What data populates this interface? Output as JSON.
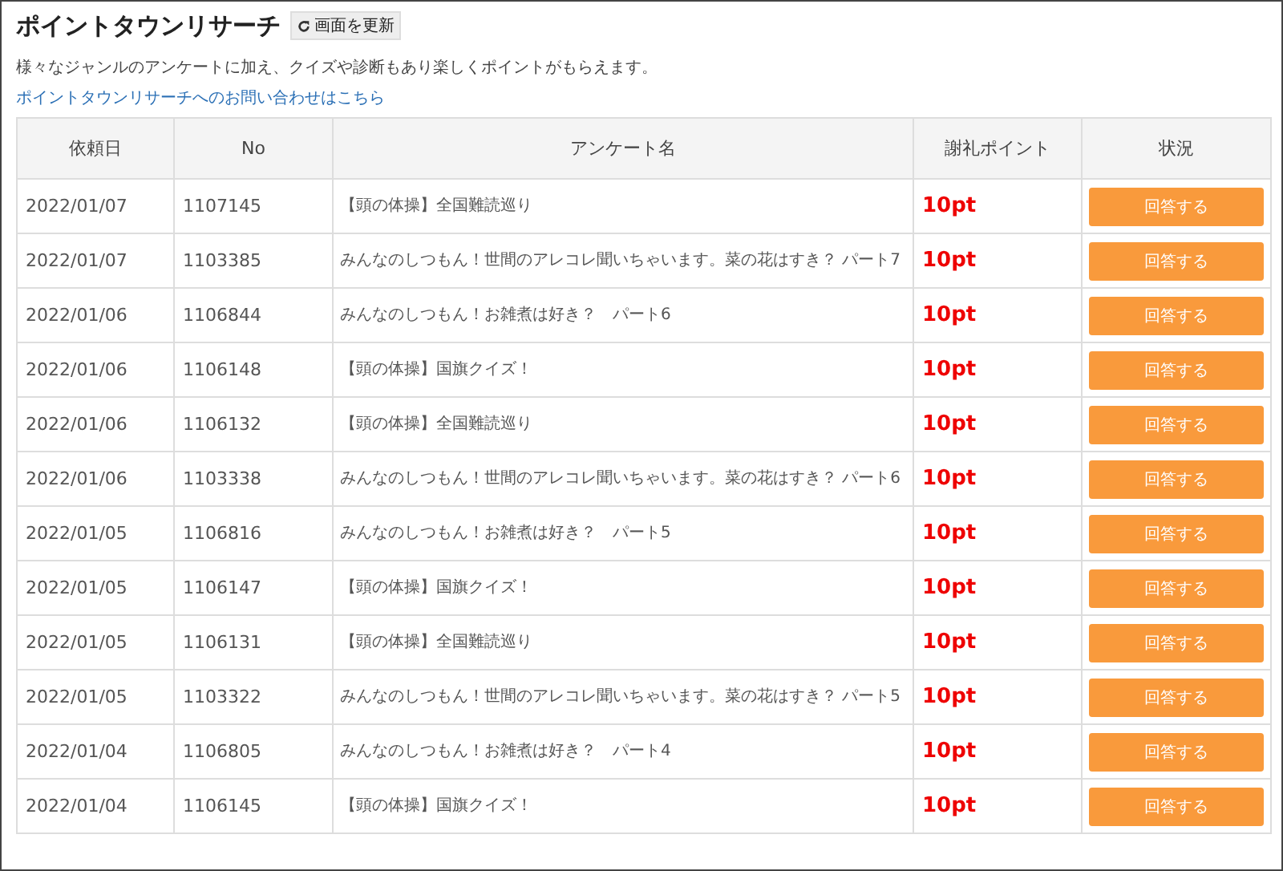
{
  "header": {
    "title": "ポイントタウンリサーチ",
    "refresh_button": "画面を更新"
  },
  "description": "様々なジャンルのアンケートに加え、クイズや診断もあり楽しくポイントがもらえます。",
  "contact_link": "ポイントタウンリサーチへのお問い合わせはこちら",
  "table": {
    "columns": [
      "依頼日",
      "No",
      "アンケート名",
      "謝礼ポイント",
      "状況"
    ],
    "rows": [
      {
        "date": "2022/01/07",
        "no": "1107145",
        "name": "【頭の体操】全国難読巡り",
        "points": "10pt",
        "action": "回答する"
      },
      {
        "date": "2022/01/07",
        "no": "1103385",
        "name": "みんなのしつもん！世間のアレコレ聞いちゃいます。菜の花はすき？ パート7",
        "points": "10pt",
        "action": "回答する"
      },
      {
        "date": "2022/01/06",
        "no": "1106844",
        "name": "みんなのしつもん！お雑煮は好き？　パート6",
        "points": "10pt",
        "action": "回答する"
      },
      {
        "date": "2022/01/06",
        "no": "1106148",
        "name": "【頭の体操】国旗クイズ！",
        "points": "10pt",
        "action": "回答する"
      },
      {
        "date": "2022/01/06",
        "no": "1106132",
        "name": "【頭の体操】全国難読巡り",
        "points": "10pt",
        "action": "回答する"
      },
      {
        "date": "2022/01/06",
        "no": "1103338",
        "name": "みんなのしつもん！世間のアレコレ聞いちゃいます。菜の花はすき？ パート6",
        "points": "10pt",
        "action": "回答する"
      },
      {
        "date": "2022/01/05",
        "no": "1106816",
        "name": "みんなのしつもん！お雑煮は好き？　パート5",
        "points": "10pt",
        "action": "回答する"
      },
      {
        "date": "2022/01/05",
        "no": "1106147",
        "name": "【頭の体操】国旗クイズ！",
        "points": "10pt",
        "action": "回答する"
      },
      {
        "date": "2022/01/05",
        "no": "1106131",
        "name": "【頭の体操】全国難読巡り",
        "points": "10pt",
        "action": "回答する"
      },
      {
        "date": "2022/01/05",
        "no": "1103322",
        "name": "みんなのしつもん！世間のアレコレ聞いちゃいます。菜の花はすき？ パート5",
        "points": "10pt",
        "action": "回答する"
      },
      {
        "date": "2022/01/04",
        "no": "1106805",
        "name": "みんなのしつもん！お雑煮は好き？　パート4",
        "points": "10pt",
        "action": "回答する"
      },
      {
        "date": "2022/01/04",
        "no": "1106145",
        "name": "【頭の体操】国旗クイズ！",
        "points": "10pt",
        "action": "回答する"
      }
    ]
  }
}
